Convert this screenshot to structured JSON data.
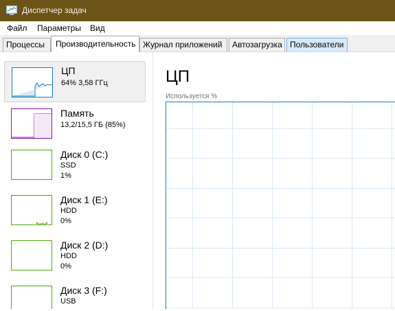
{
  "window": {
    "title": "Диспетчер задач"
  },
  "menu": [
    "Файл",
    "Параметры",
    "Вид"
  ],
  "tabs": [
    "Процессы",
    "Производительность",
    "Журнал приложений",
    "Автозагрузка",
    "Пользователи"
  ],
  "active_tab": "Производительность",
  "resources": [
    {
      "name": "ЦП",
      "details": [
        "64%  3,58 ГГц"
      ],
      "color": "#117dbb",
      "selected": true,
      "usage": 0.64
    },
    {
      "name": "Память",
      "details": [
        "13,2/15,5 ГБ (85%)"
      ],
      "color": "#8b12ae",
      "selected": false,
      "usage": 0.85
    },
    {
      "name": "Диск 0 (C:)",
      "details": [
        "SSD",
        "1%"
      ],
      "color": "#4da60c",
      "selected": false,
      "usage": 0.01
    },
    {
      "name": "Диск 1 (E:)",
      "details": [
        "HDD",
        "0%"
      ],
      "color": "#4da60c",
      "selected": false,
      "usage": 0.0
    },
    {
      "name": "Диск 2 (D:)",
      "details": [
        "HDD",
        "0%"
      ],
      "color": "#4da60c",
      "selected": false,
      "usage": 0.0
    },
    {
      "name": "Диск 3 (F:)",
      "details": [
        "USB"
      ],
      "color": "#4da60c",
      "selected": false,
      "usage": 0.0
    }
  ],
  "main": {
    "title": "ЦП",
    "graph_label": "Используется %",
    "graph_color": "#117dbb",
    "grid_color": "#d9eaf4"
  }
}
